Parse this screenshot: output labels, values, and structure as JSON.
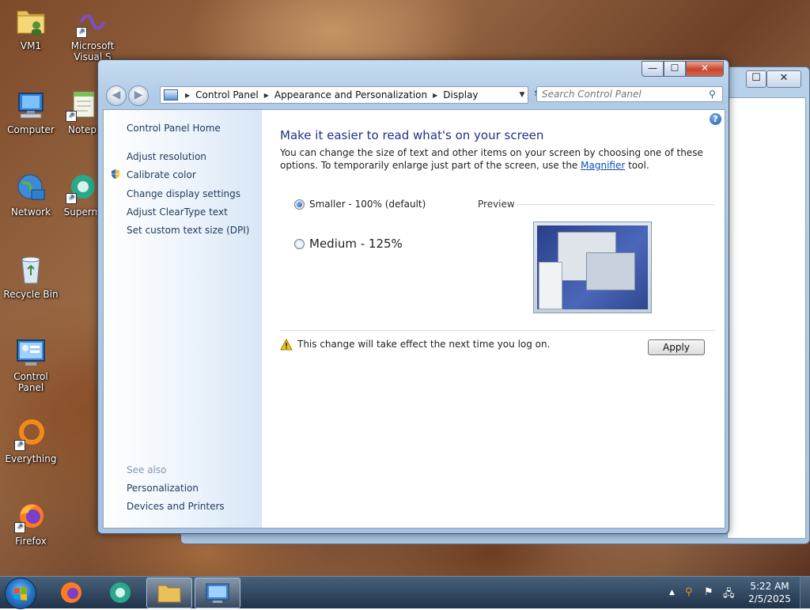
{
  "desktop": {
    "icons": [
      {
        "label": "VM1"
      },
      {
        "label": "Microsoft Visual S"
      },
      {
        "label": "Computer"
      },
      {
        "label": "Notep"
      },
      {
        "label": "Network"
      },
      {
        "label": "Superm"
      },
      {
        "label": "Recycle Bin"
      },
      {
        "label": "Control Panel"
      },
      {
        "label": "Everything"
      },
      {
        "label": "Firefox"
      }
    ]
  },
  "window": {
    "caption_buttons": {
      "minimize": "—",
      "maximize": "☐",
      "close": "✕"
    },
    "address": {
      "crumbs": [
        "Control Panel",
        "Appearance and Personalization",
        "Display"
      ]
    },
    "search_placeholder": "Search Control Panel",
    "left_pane": {
      "home": "Control Panel Home",
      "links": [
        "Adjust resolution",
        "Calibrate color",
        "Change display settings",
        "Adjust ClearType text",
        "Set custom text size (DPI)"
      ],
      "see_also_label": "See also",
      "see_also": [
        "Personalization",
        "Devices and Printers"
      ]
    },
    "main": {
      "title": "Make it easier to read what's on your screen",
      "description_pre": "You can change the size of text and other items on your screen by choosing one of these options. To temporarily enlarge just part of the screen, use the ",
      "description_link": "Magnifier",
      "description_post": " tool.",
      "options": [
        {
          "label": "Smaller - 100% (default)",
          "selected": true
        },
        {
          "label": "Medium - 125%",
          "selected": false
        }
      ],
      "preview_label": "Preview",
      "warning": "This change will take effect the next time you log on.",
      "apply_label": "Apply"
    }
  },
  "taskbar": {
    "clock_time": "5:22 AM",
    "clock_date": "2/5/2025"
  },
  "colors": {
    "link": "#1e395b",
    "title": "#1e3287",
    "hyperlink": "#0b4fb5"
  }
}
